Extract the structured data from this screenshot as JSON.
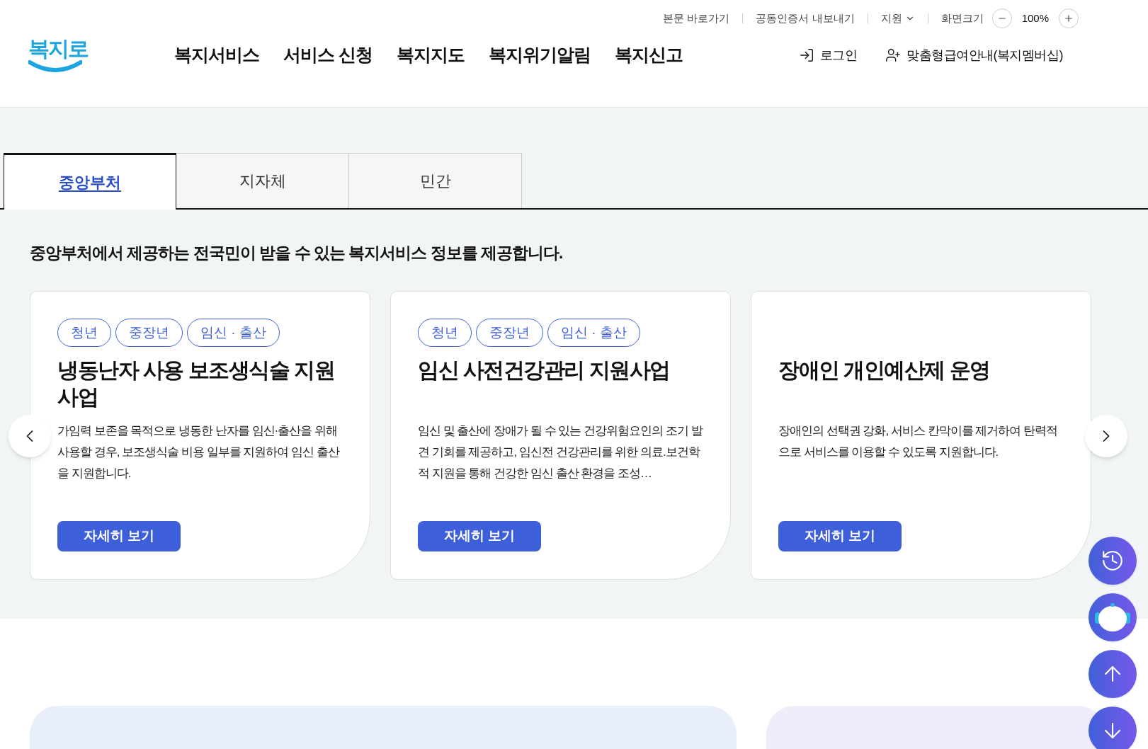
{
  "utility_links": [
    {
      "label": "본문 바로가기",
      "kind": "link"
    },
    {
      "label": "공동인증서 내보내기",
      "kind": "link"
    },
    {
      "label": "지원",
      "kind": "dropdown"
    }
  ],
  "zoom": {
    "label": "화면크기",
    "value": "100%"
  },
  "logo": {
    "text": "복지로"
  },
  "main_nav": [
    "복지서비스",
    "서비스 신청",
    "복지지도",
    "복지위기알림",
    "복지신고"
  ],
  "user_links": [
    {
      "label": "로그인",
      "kind": "login"
    },
    {
      "label": "맞춤형급여안내(복지멤버십)",
      "kind": "member"
    }
  ],
  "tabs": [
    {
      "label": "중앙부처",
      "selected": true
    },
    {
      "label": "지자체",
      "selected": false
    },
    {
      "label": "민간",
      "selected": false
    }
  ],
  "intro": "중앙부처에서 제공하는 전국민이 받을 수 있는 복지서비스 정보를 제공합니다.",
  "cards": [
    {
      "tags": [
        "청년",
        "중장년",
        "임신 · 출산"
      ],
      "title": "냉동난자 사용 보조생식술 지원사업",
      "description": "가임력 보존을 목적으로 냉동한 난자를 임신·출산을 위해 사용할 경우, 보조생식술 비용 일부를 지원하여 임신 출산을 지원합니다.",
      "button": "자세히 보기"
    },
    {
      "tags": [
        "청년",
        "중장년",
        "임신 · 출산"
      ],
      "title": "임신 사전건강관리 지원사업",
      "description": "임신 및 출산에 장애가 될 수 있는 건강위험요인의 조기 발견 기회를 제공하고, 임신전 건강관리를 위한 의료.보건학적 지원을 통해 건강한 임신 출산 환경을 조성…",
      "button": "자세히 보기"
    },
    {
      "title": "장애인 개인예산제 운영",
      "description": "장애인의 선택권 강화, 서비스 칸막이를 제거하여 탄력적으로 서비스를 이용할 수 있도록 지원합니다.",
      "button": "자세히 보기"
    }
  ],
  "floating_buttons": [
    {
      "kind": "history"
    },
    {
      "kind": "chatbot"
    },
    {
      "kind": "up"
    },
    {
      "kind": "down"
    }
  ]
}
